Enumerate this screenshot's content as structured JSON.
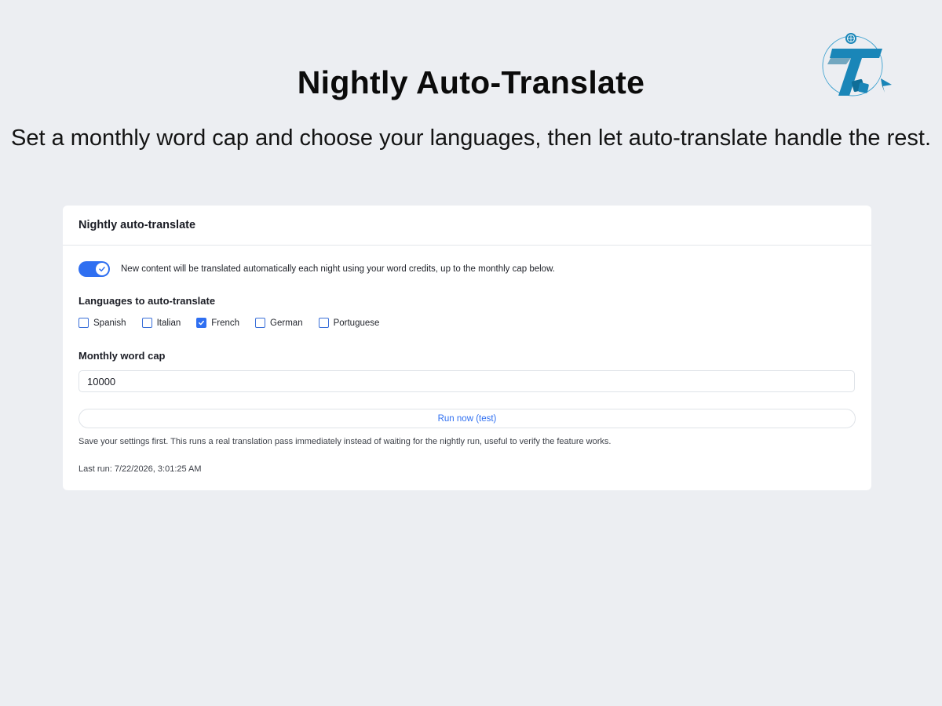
{
  "page": {
    "title": "Nightly Auto-Translate",
    "subtitle": "Set a monthly word cap and choose your languages, then let auto-translate handle the rest."
  },
  "card": {
    "title": "Nightly auto-translate",
    "toggle": {
      "enabled": true,
      "description": "New content will be translated automatically each night using your word credits, up to the monthly cap below."
    },
    "languages_label": "Languages to auto-translate",
    "languages": [
      {
        "label": "Spanish",
        "checked": false
      },
      {
        "label": "Italian",
        "checked": false
      },
      {
        "label": "French",
        "checked": true
      },
      {
        "label": "German",
        "checked": false
      },
      {
        "label": "Portuguese",
        "checked": false
      }
    ],
    "word_cap_label": "Monthly word cap",
    "word_cap_value": "10000",
    "run_button_label": "Run now (test)",
    "help_text": "Save your settings first. This runs a real translation pass immediately instead of waiting for the nightly run, useful to verify the feature works.",
    "last_run": "Last run: 7/22/2026, 3:01:25 AM"
  },
  "colors": {
    "accent": "#2f6ff1",
    "background": "#eceef2",
    "logo_primary": "#1a86b8"
  },
  "icons": {
    "logo": "translate-t-logo-icon",
    "toggle_check": "check-icon"
  }
}
